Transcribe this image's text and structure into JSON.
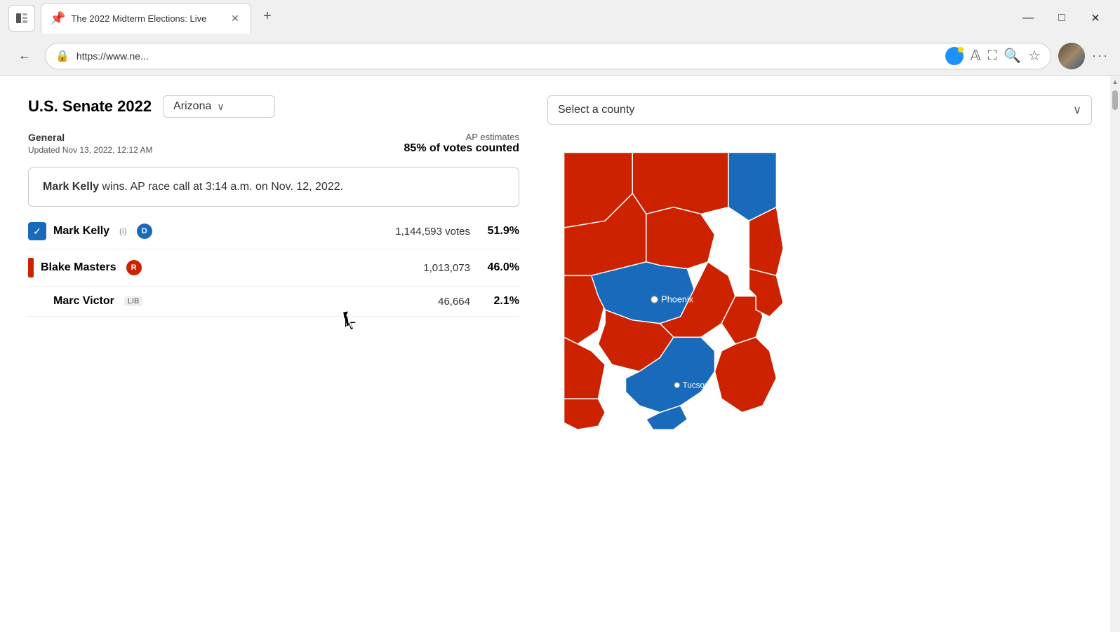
{
  "browser": {
    "tab_title": "The 2022 Midterm Elections: Live",
    "url": "https://www.ne...",
    "new_tab_label": "+",
    "window_controls": {
      "minimize": "—",
      "maximize": "□",
      "close": "✕"
    }
  },
  "election": {
    "title": "U.S. Senate 2022",
    "state": "Arizona",
    "general_label": "General",
    "updated_text": "Updated Nov 13, 2022, 12:12 AM",
    "ap_estimates_label": "AP estimates",
    "votes_counted": "85% of votes counted",
    "race_call": "Mark Kelly wins. AP race call at 3:14 a.m. on Nov. 12, 2022.",
    "candidates": [
      {
        "name": "Mark Kelly",
        "badges": [
          "(i)",
          "D"
        ],
        "votes": "1,144,593 votes",
        "pct": "51.9%",
        "party": "D",
        "winner": true
      },
      {
        "name": "Blake Masters",
        "badges": [
          "R"
        ],
        "votes": "1,013,073",
        "pct": "46.0%",
        "party": "R",
        "winner": false
      },
      {
        "name": "Marc Victor",
        "badges": [
          "LIB"
        ],
        "votes": "46,664",
        "pct": "2.1%",
        "party": "LIB",
        "winner": false
      }
    ]
  },
  "map": {
    "county_dropdown_label": "Select a county",
    "phoenix_label": "Phoenix",
    "tucson_label": "Tucson"
  },
  "icons": {
    "sidebar": "▣",
    "pin": "📌",
    "back": "←",
    "lock": "🔒",
    "read_aloud": "🔊",
    "immersive": "⛶",
    "zoom_out": "🔍",
    "add_favorite": "☆",
    "more": "···",
    "dropdown_arrow": "∨",
    "check": "✓"
  }
}
